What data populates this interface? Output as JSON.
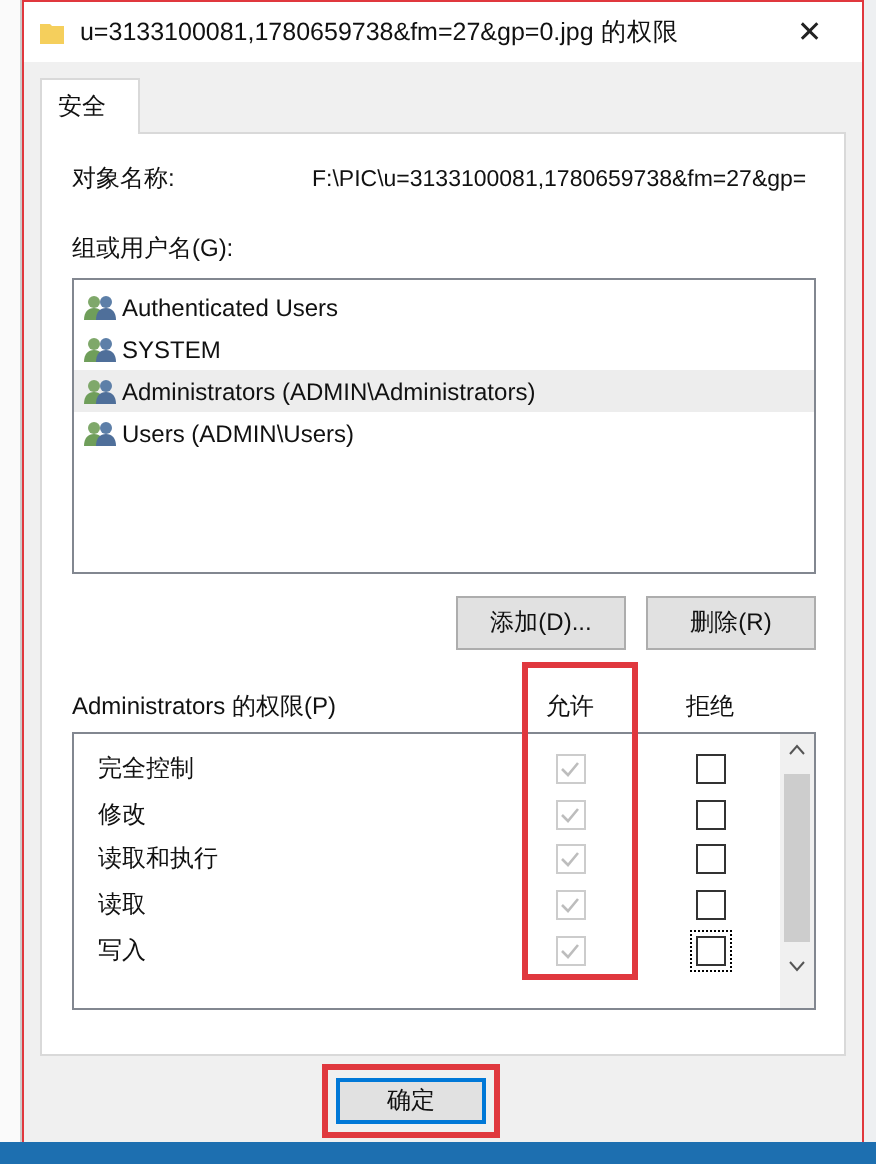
{
  "window": {
    "title": "u=3133100081,1780659738&fm=27&gp=0.jpg 的权限",
    "close": "✕"
  },
  "tabs": [
    {
      "label": "安全",
      "selected": true
    }
  ],
  "object": {
    "label": "对象名称:",
    "value": "F:\\PIC\\u=3133100081,1780659738&fm=27&gp="
  },
  "groups": {
    "label": "组或用户名(G):",
    "items": [
      {
        "name": "Authenticated Users",
        "selected": false
      },
      {
        "name": "SYSTEM",
        "selected": false
      },
      {
        "name": "Administrators (ADMIN\\Administrators)",
        "selected": true
      },
      {
        "name": "Users (ADMIN\\Users)",
        "selected": false
      }
    ]
  },
  "group_buttons": [
    "添加(D)...",
    "删除(R)"
  ],
  "permissions": {
    "label": "Administrators 的权限(P)",
    "allow_header": "允许",
    "deny_header": "拒绝",
    "rows": [
      {
        "name": "完全控制",
        "allow": true,
        "deny": false,
        "disabled": true,
        "focused": false
      },
      {
        "name": "修改",
        "allow": true,
        "deny": false,
        "disabled": true,
        "focused": false
      },
      {
        "name": "读取和执行",
        "allow": true,
        "deny": false,
        "disabled": true,
        "focused": false
      },
      {
        "name": "读取",
        "allow": true,
        "deny": false,
        "disabled": true,
        "focused": false
      },
      {
        "name": "写入",
        "allow": true,
        "deny": false,
        "disabled": true,
        "focused": true
      }
    ]
  },
  "footer_buttons": [
    "确定"
  ]
}
